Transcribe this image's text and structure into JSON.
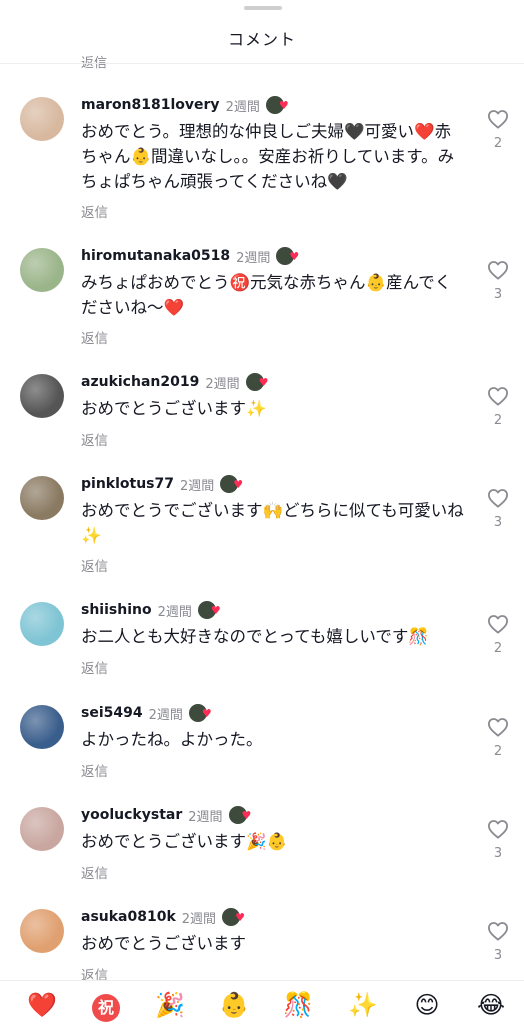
{
  "header": {
    "title": "コメント",
    "cut_reply_label": "返信"
  },
  "comments": [
    {
      "user": "maron8181lovery",
      "time": "2週間",
      "text": "おめでとう。理想的な仲良しご夫婦🖤可愛い❤️赤ちゃん👶間違いなし。。安産お祈りしています。みちょぱちゃん頑張ってくださいね🖤",
      "reply": "返信",
      "likes": "2",
      "avatar_color": "#d8b9a0"
    },
    {
      "user": "hiromutanaka0518",
      "time": "2週間",
      "text": "みちょぱおめでとう㊗️元気な赤ちゃん👶産んでくださいね〜❤️",
      "reply": "返信",
      "likes": "3",
      "avatar_color": "#9bb58a"
    },
    {
      "user": "azukichan2019",
      "time": "2週間",
      "text": "おめでとうございます✨",
      "reply": "返信",
      "likes": "2",
      "avatar_color": "#555555"
    },
    {
      "user": "pinklotus77",
      "time": "2週間",
      "text": "おめでとうでございます🙌どちらに似ても可愛いね✨",
      "reply": "返信",
      "likes": "3",
      "avatar_color": "#8a7a62"
    },
    {
      "user": "shiishino",
      "time": "2週間",
      "text": "お二人とも大好きなのでとっても嬉しいです🎊",
      "reply": "返信",
      "likes": "2",
      "avatar_color": "#7fc4d4"
    },
    {
      "user": "sei5494",
      "time": "2週間",
      "text": "よかったね。よかった。",
      "reply": "返信",
      "likes": "2",
      "avatar_color": "#3a5e8c"
    },
    {
      "user": "yooluckystar",
      "time": "2週間",
      "text": "おめでとうございます🎉👶",
      "reply": "返信",
      "likes": "3",
      "avatar_color": "#c9a7a0"
    },
    {
      "user": "asuka0810k",
      "time": "2週間",
      "text": "おめでとうございます",
      "reply": "返信",
      "likes": "3",
      "avatar_color": "#e0a070"
    }
  ],
  "emoji_bar": [
    "❤️",
    "㊗️",
    "🎉",
    "👶",
    "🎊",
    "✨",
    "😊",
    "😂"
  ],
  "colors": {
    "like_gray": "#8a8b91",
    "accent_red": "#fe2c55"
  }
}
